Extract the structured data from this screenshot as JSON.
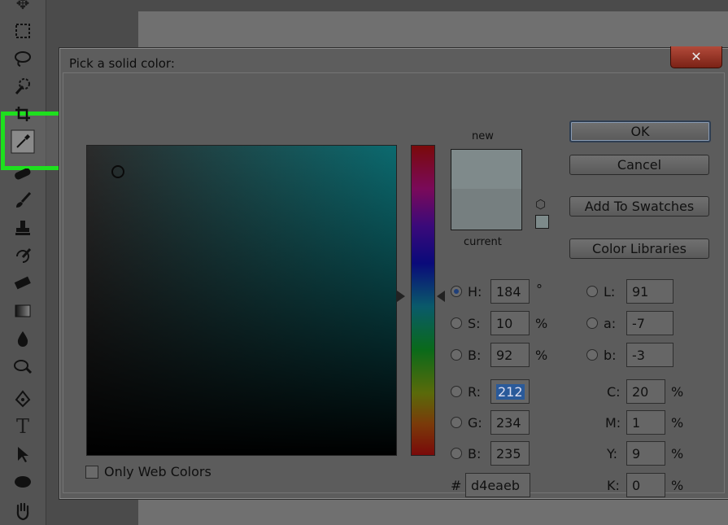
{
  "dialog": {
    "title": "Pick a solid color:",
    "close_symbol": "✕",
    "swatch_new_label": "new",
    "swatch_current_label": "current",
    "swatch_new_color": "#7f8a8b",
    "swatch_current_color": "#767f80",
    "buttons": {
      "ok": "OK",
      "cancel": "Cancel",
      "add_swatches": "Add To Swatches",
      "color_libraries": "Color Libraries"
    },
    "only_web_colors": "Only Web Colors",
    "hsb": {
      "h": {
        "label": "H:",
        "value": "184",
        "unit": "°"
      },
      "s": {
        "label": "S:",
        "value": "10",
        "unit": "%"
      },
      "b": {
        "label": "B:",
        "value": "92",
        "unit": "%"
      }
    },
    "rgb": {
      "r": {
        "label": "R:",
        "value": "212"
      },
      "g": {
        "label": "G:",
        "value": "234"
      },
      "b": {
        "label": "B:",
        "value": "235"
      }
    },
    "hex": {
      "label": "#",
      "value": "d4eaeb"
    },
    "lab": {
      "l": {
        "label": "L:",
        "value": "91"
      },
      "a": {
        "label": "a:",
        "value": "-7"
      },
      "b": {
        "label": "b:",
        "value": "-3"
      }
    },
    "cmyk": {
      "c": {
        "label": "C:",
        "value": "20",
        "unit": "%"
      },
      "m": {
        "label": "M:",
        "value": "1",
        "unit": "%"
      },
      "y": {
        "label": "Y:",
        "value": "9",
        "unit": "%"
      },
      "k": {
        "label": "K:",
        "value": "0",
        "unit": "%"
      }
    }
  },
  "toolbar": {
    "tools": [
      "move-tool-icon",
      "marquee-tool-icon",
      "lasso-tool-icon",
      "quick-selection-tool-icon",
      "crop-tool-icon",
      "eyedropper-tool-icon",
      "healing-brush-tool-icon",
      "brush-tool-icon",
      "clone-stamp-tool-icon",
      "history-brush-tool-icon",
      "eraser-tool-icon",
      "gradient-tool-icon",
      "blur-tool-icon",
      "dodge-tool-icon",
      "pen-tool-icon",
      "type-tool-icon",
      "path-selection-tool-icon",
      "ellipse-tool-icon",
      "hand-tool-icon"
    ],
    "type_glyph": "T",
    "highlight_color": "#1ee01e"
  }
}
